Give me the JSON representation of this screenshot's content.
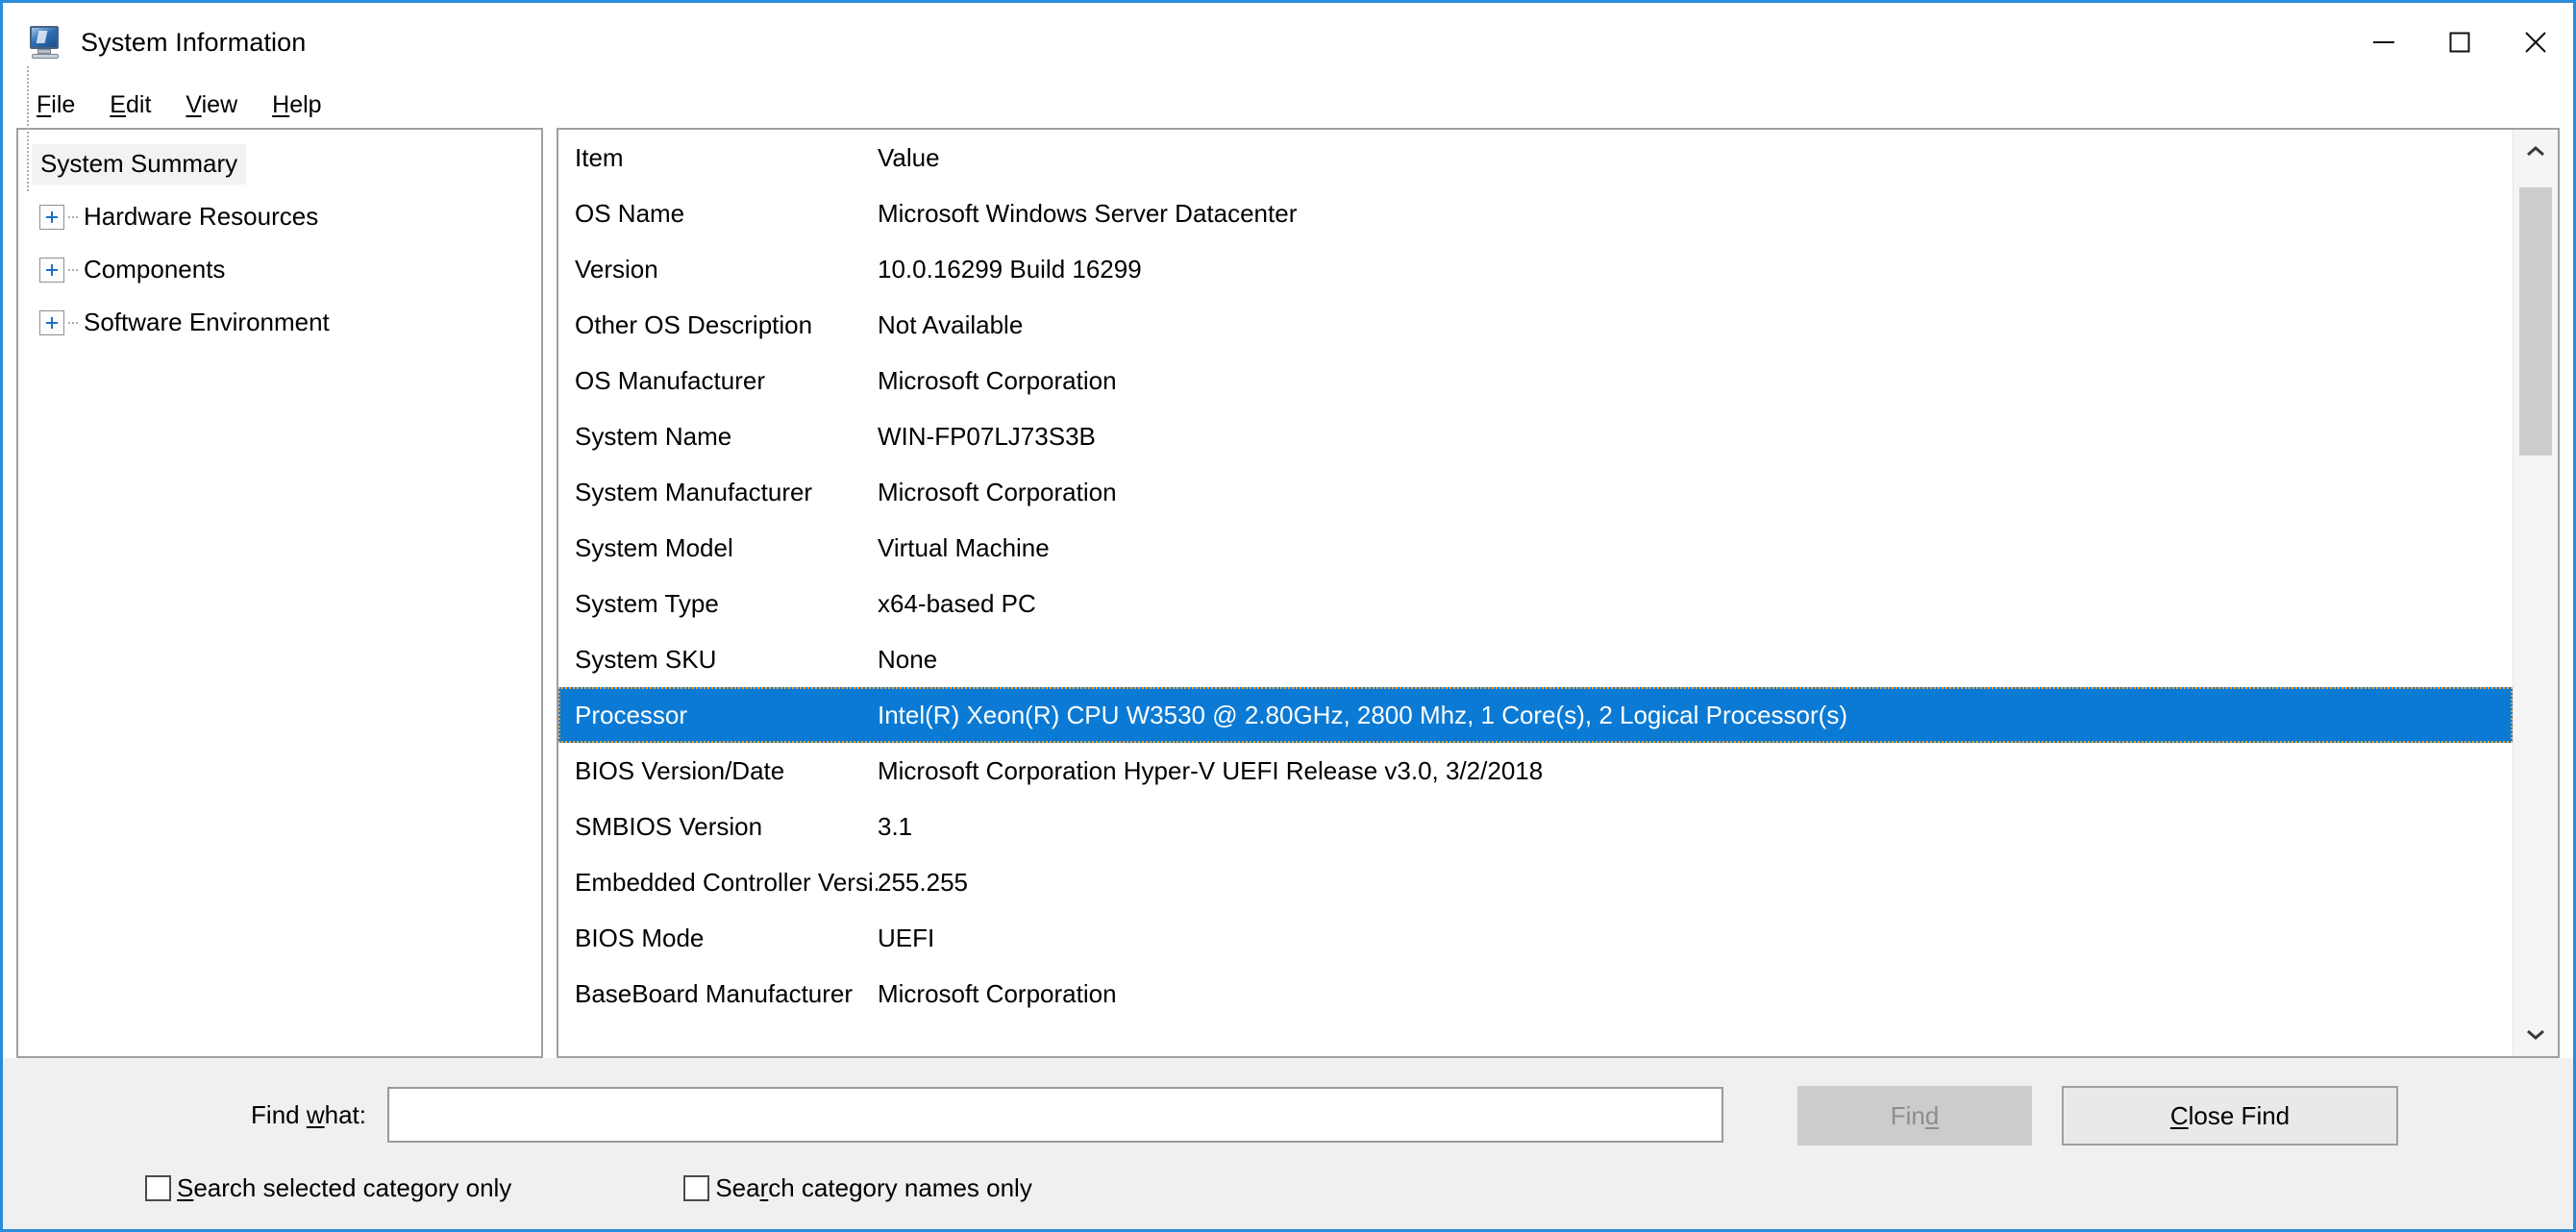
{
  "window": {
    "title": "System Information",
    "icon": "system-information-icon",
    "controls": {
      "minimize": "minimize-icon",
      "maximize": "maximize-icon",
      "close": "close-icon"
    },
    "accent_color": "#2a8ddb"
  },
  "menubar": {
    "items": [
      {
        "label": "File",
        "accel": "F",
        "rest": "ile"
      },
      {
        "label": "Edit",
        "accel": "E",
        "rest": "dit"
      },
      {
        "label": "View",
        "accel": "V",
        "rest": "iew"
      },
      {
        "label": "Help",
        "accel": "H",
        "rest": "elp"
      }
    ]
  },
  "tree": {
    "selected": "System Summary",
    "items": [
      {
        "label": "System Summary",
        "expandable": false,
        "selected": true
      },
      {
        "label": "Hardware Resources",
        "expandable": true,
        "selected": false
      },
      {
        "label": "Components",
        "expandable": true,
        "selected": false
      },
      {
        "label": "Software Environment",
        "expandable": true,
        "selected": false
      }
    ]
  },
  "list": {
    "columns": [
      "Item",
      "Value"
    ],
    "selected_index": 10,
    "rows": [
      {
        "item": "OS Name",
        "value": "Microsoft Windows Server Datacenter"
      },
      {
        "item": "Version",
        "value": "10.0.16299 Build 16299"
      },
      {
        "item": "Other OS Description",
        "value": "Not Available"
      },
      {
        "item": "OS Manufacturer",
        "value": "Microsoft Corporation"
      },
      {
        "item": "System Name",
        "value": "WIN-FP07LJ73S3B"
      },
      {
        "item": "System Manufacturer",
        "value": "Microsoft Corporation"
      },
      {
        "item": "System Model",
        "value": "Virtual Machine"
      },
      {
        "item": "System Type",
        "value": "x64-based PC"
      },
      {
        "item": "System SKU",
        "value": "None"
      },
      {
        "item": "Processor",
        "value": "Intel(R) Xeon(R) CPU           W3530  @ 2.80GHz, 2800 Mhz, 1 Core(s), 2 Logical Processor(s)"
      },
      {
        "item": "BIOS Version/Date",
        "value": "Microsoft Corporation Hyper-V UEFI Release v3.0, 3/2/2018"
      },
      {
        "item": "SMBIOS Version",
        "value": "3.1"
      },
      {
        "item": "Embedded Controller Versi...",
        "value": "255.255"
      },
      {
        "item": "BIOS Mode",
        "value": "UEFI"
      },
      {
        "item": "BaseBoard Manufacturer",
        "value": "Microsoft Corporation"
      }
    ],
    "selection_color": "#0b7ad4",
    "scrollbar": {
      "up": "chevron-up-icon",
      "down": "chevron-down-icon",
      "thumb_position": "top"
    }
  },
  "find_panel": {
    "label": "Find what:",
    "label_pre": "Find ",
    "label_accel": "w",
    "label_post": "hat:",
    "input_value": "",
    "input_placeholder": "",
    "find_button": {
      "pre": "Fin",
      "accel": "d",
      "post": "",
      "label": "Find",
      "enabled": false
    },
    "close_button": {
      "pre": "",
      "accel": "C",
      "post": "lose Find",
      "label": "Close Find",
      "enabled": true
    },
    "checkboxes": [
      {
        "pre": "",
        "accel": "S",
        "post": "earch selected category only",
        "label": "Search selected category only",
        "checked": false
      },
      {
        "pre": "Sea",
        "accel": "r",
        "post": "ch category names only",
        "label": "Search category names only",
        "checked": false
      }
    ]
  }
}
